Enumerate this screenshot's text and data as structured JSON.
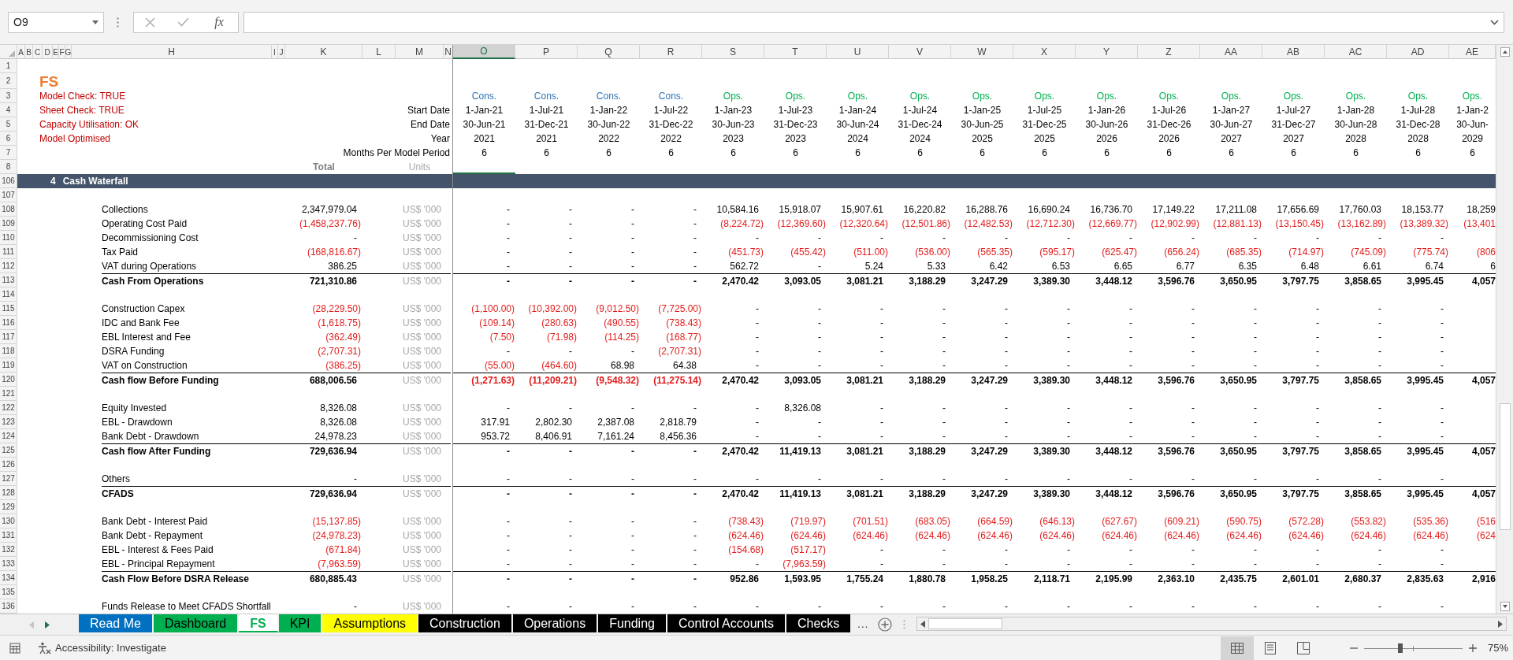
{
  "name_box": "O9",
  "function_button": "fx",
  "columns": [
    {
      "label": "A",
      "selected": false
    },
    {
      "label": "B",
      "selected": false
    },
    {
      "label": "C",
      "selected": false
    },
    {
      "label": "D",
      "selected": false
    },
    {
      "label": "E",
      "selected": false
    },
    {
      "label": "F",
      "selected": false
    },
    {
      "label": "G",
      "selected": false
    },
    {
      "label": "H",
      "selected": false
    },
    {
      "label": "I",
      "selected": false
    },
    {
      "label": "J",
      "selected": false
    },
    {
      "label": "K",
      "selected": false
    },
    {
      "label": "L",
      "selected": false
    },
    {
      "label": "M",
      "selected": false
    },
    {
      "label": "N",
      "selected": false
    },
    {
      "label": "O",
      "selected": true
    },
    {
      "label": "P",
      "selected": false
    },
    {
      "label": "Q",
      "selected": false
    },
    {
      "label": "R",
      "selected": false
    },
    {
      "label": "S",
      "selected": false
    },
    {
      "label": "T",
      "selected": false
    },
    {
      "label": "U",
      "selected": false
    },
    {
      "label": "V",
      "selected": false
    },
    {
      "label": "W",
      "selected": false
    },
    {
      "label": "X",
      "selected": false
    },
    {
      "label": "Y",
      "selected": false
    },
    {
      "label": "Z",
      "selected": false
    },
    {
      "label": "AA",
      "selected": false
    },
    {
      "label": "AB",
      "selected": false
    },
    {
      "label": "AC",
      "selected": false
    },
    {
      "label": "AD",
      "selected": false
    },
    {
      "label": "AE",
      "selected": false
    }
  ],
  "sheet": {
    "title": "FS",
    "top_row_numbers": [
      "1",
      "2",
      "3",
      "4",
      "5",
      "6",
      "7",
      "8"
    ],
    "checks": [
      "Model Check: TRUE",
      "Sheet Check: TRUE",
      "Capacity Utilisation: OK",
      "Model Optimised"
    ],
    "period_labels": [
      "Start Date",
      "End Date",
      "Year",
      "Months Per Model Period"
    ],
    "total_heading": "Total",
    "units_heading": "Units",
    "periods": [
      {
        "phase": "Cons.",
        "color": "#2e75b6",
        "start": "1-Jan-21",
        "end": "30-Jun-21",
        "year": "2021",
        "months": "6"
      },
      {
        "phase": "Cons.",
        "color": "#2e75b6",
        "start": "1-Jul-21",
        "end": "31-Dec-21",
        "year": "2021",
        "months": "6"
      },
      {
        "phase": "Cons.",
        "color": "#2e75b6",
        "start": "1-Jan-22",
        "end": "30-Jun-22",
        "year": "2022",
        "months": "6"
      },
      {
        "phase": "Cons.",
        "color": "#2e75b6",
        "start": "1-Jul-22",
        "end": "31-Dec-22",
        "year": "2022",
        "months": "6"
      },
      {
        "phase": "Ops.",
        "color": "#00b050",
        "start": "1-Jan-23",
        "end": "30-Jun-23",
        "year": "2023",
        "months": "6"
      },
      {
        "phase": "Ops.",
        "color": "#00b050",
        "start": "1-Jul-23",
        "end": "31-Dec-23",
        "year": "2023",
        "months": "6"
      },
      {
        "phase": "Ops.",
        "color": "#00b050",
        "start": "1-Jan-24",
        "end": "30-Jun-24",
        "year": "2024",
        "months": "6"
      },
      {
        "phase": "Ops.",
        "color": "#00b050",
        "start": "1-Jul-24",
        "end": "31-Dec-24",
        "year": "2024",
        "months": "6"
      },
      {
        "phase": "Ops.",
        "color": "#00b050",
        "start": "1-Jan-25",
        "end": "30-Jun-25",
        "year": "2025",
        "months": "6"
      },
      {
        "phase": "Ops.",
        "color": "#00b050",
        "start": "1-Jul-25",
        "end": "31-Dec-25",
        "year": "2025",
        "months": "6"
      },
      {
        "phase": "Ops.",
        "color": "#00b050",
        "start": "1-Jan-26",
        "end": "30-Jun-26",
        "year": "2026",
        "months": "6"
      },
      {
        "phase": "Ops.",
        "color": "#00b050",
        "start": "1-Jul-26",
        "end": "31-Dec-26",
        "year": "2026",
        "months": "6"
      },
      {
        "phase": "Ops.",
        "color": "#00b050",
        "start": "1-Jan-27",
        "end": "30-Jun-27",
        "year": "2027",
        "months": "6"
      },
      {
        "phase": "Ops.",
        "color": "#00b050",
        "start": "1-Jul-27",
        "end": "31-Dec-27",
        "year": "2027",
        "months": "6"
      },
      {
        "phase": "Ops.",
        "color": "#00b050",
        "start": "1-Jan-28",
        "end": "30-Jun-28",
        "year": "2028",
        "months": "6"
      },
      {
        "phase": "Ops.",
        "color": "#00b050",
        "start": "1-Jul-28",
        "end": "31-Dec-28",
        "year": "2028",
        "months": "6"
      },
      {
        "phase": "Ops.",
        "color": "#00b050",
        "start": "1-Jan-2",
        "end": "30-Jun-",
        "year": "2029",
        "months": "6"
      }
    ],
    "section": {
      "row_number": "106",
      "number": "4",
      "title": "Cash Waterfall"
    },
    "rows": [
      {
        "number": "107",
        "kind": "blank"
      },
      {
        "number": "108",
        "kind": "item",
        "label": "Collections",
        "total": "2,347,979.04",
        "units": "US$ '000",
        "values": [
          "-",
          "-",
          "-",
          "-",
          "10,584.16",
          "15,918.07",
          "15,907.61",
          "16,220.82",
          "16,288.76",
          "16,690.24",
          "16,736.70",
          "17,149.22",
          "17,211.08",
          "17,656.69",
          "17,760.03",
          "18,153.77",
          "18,259"
        ]
      },
      {
        "number": "109",
        "kind": "item",
        "label": "Operating Cost Paid",
        "total": "(1,458,237.76)",
        "total_negative": true,
        "units": "US$ '000",
        "values": [
          "-",
          "-",
          "-",
          "-",
          "(8,224.72)",
          "(12,369.60)",
          "(12,320.64)",
          "(12,501.86)",
          "(12,482.53)",
          "(12,712.30)",
          "(12,669.77)",
          "(12,902.99)",
          "(12,881.13)",
          "(13,150.45)",
          "(13,162.89)",
          "(13,389.32)",
          "(13,401"
        ],
        "negative": [
          false,
          false,
          false,
          false,
          true,
          true,
          true,
          true,
          true,
          true,
          true,
          true,
          true,
          true,
          true,
          true,
          true
        ]
      },
      {
        "number": "110",
        "kind": "item",
        "label": "Decommissioning Cost",
        "total": "-",
        "units": "US$ '000",
        "values": [
          "-",
          "-",
          "-",
          "-",
          "-",
          "-",
          "-",
          "-",
          "-",
          "-",
          "-",
          "-",
          "-",
          "-",
          "-",
          "-"
        ]
      },
      {
        "number": "111",
        "kind": "item",
        "label": "Tax Paid",
        "total": "(168,816.67)",
        "total_negative": true,
        "units": "US$ '000",
        "values": [
          "-",
          "-",
          "-",
          "-",
          "(451.73)",
          "(455.42)",
          "(511.00)",
          "(536.00)",
          "(565.35)",
          "(595.17)",
          "(625.47)",
          "(656.24)",
          "(685.35)",
          "(714.97)",
          "(745.09)",
          "(775.74)",
          "(806"
        ],
        "negative": [
          false,
          false,
          false,
          false,
          true,
          true,
          true,
          true,
          true,
          true,
          true,
          true,
          true,
          true,
          true,
          true,
          true
        ]
      },
      {
        "number": "112",
        "kind": "item",
        "label": "VAT during Operations",
        "total": "386.25",
        "units": "US$ '000",
        "values": [
          "-",
          "-",
          "-",
          "-",
          "562.72",
          "-",
          "5.24",
          "5.33",
          "6.42",
          "6.53",
          "6.65",
          "6.77",
          "6.35",
          "6.48",
          "6.61",
          "6.74",
          "6"
        ]
      },
      {
        "number": "113",
        "kind": "total",
        "label": "Cash From Operations",
        "total": "721,310.86",
        "units": "US$ '000",
        "values": [
          "-",
          "-",
          "-",
          "-",
          "2,470.42",
          "3,093.05",
          "3,081.21",
          "3,188.29",
          "3,247.29",
          "3,389.30",
          "3,448.12",
          "3,596.76",
          "3,650.95",
          "3,797.75",
          "3,858.65",
          "3,995.45",
          "4,057"
        ]
      },
      {
        "number": "114",
        "kind": "blank"
      },
      {
        "number": "115",
        "kind": "item",
        "label": "Construction Capex",
        "total": "(28,229.50)",
        "total_negative": true,
        "units": "US$ '000",
        "values": [
          "(1,100.00)",
          "(10,392.00)",
          "(9,012.50)",
          "(7,725.00)",
          "-",
          "-",
          "-",
          "-",
          "-",
          "-",
          "-",
          "-",
          "-",
          "-",
          "-",
          "-"
        ],
        "negative": [
          true,
          true,
          true,
          true,
          false,
          false,
          false,
          false,
          false,
          false,
          false,
          false,
          false,
          false,
          false,
          false
        ]
      },
      {
        "number": "116",
        "kind": "item",
        "label": "IDC and Bank Fee",
        "total": "(1,618.75)",
        "total_negative": true,
        "units": "US$ '000",
        "values": [
          "(109.14)",
          "(280.63)",
          "(490.55)",
          "(738.43)",
          "-",
          "-",
          "-",
          "-",
          "-",
          "-",
          "-",
          "-",
          "-",
          "-",
          "-",
          "-"
        ],
        "negative": [
          true,
          true,
          true,
          true,
          false,
          false,
          false,
          false,
          false,
          false,
          false,
          false,
          false,
          false,
          false,
          false
        ]
      },
      {
        "number": "117",
        "kind": "item",
        "label": "EBL Interest and Fee",
        "total": "(362.49)",
        "total_negative": true,
        "units": "US$ '000",
        "values": [
          "(7.50)",
          "(71.98)",
          "(114.25)",
          "(168.77)",
          "-",
          "-",
          "-",
          "-",
          "-",
          "-",
          "-",
          "-",
          "-",
          "-",
          "-",
          "-"
        ],
        "negative": [
          true,
          true,
          true,
          true,
          false,
          false,
          false,
          false,
          false,
          false,
          false,
          false,
          false,
          false,
          false,
          false
        ]
      },
      {
        "number": "118",
        "kind": "item",
        "label": "DSRA Funding",
        "total": "(2,707.31)",
        "total_negative": true,
        "units": "US$ '000",
        "values": [
          "-",
          "-",
          "-",
          "(2,707.31)",
          "-",
          "-",
          "-",
          "-",
          "-",
          "-",
          "-",
          "-",
          "-",
          "-",
          "-",
          "-"
        ],
        "negative": [
          false,
          false,
          false,
          true,
          false,
          false,
          false,
          false,
          false,
          false,
          false,
          false,
          false,
          false,
          false,
          false
        ]
      },
      {
        "number": "119",
        "kind": "item",
        "label": "VAT on Construction",
        "total": "(386.25)",
        "total_negative": true,
        "units": "US$ '000",
        "values": [
          "(55.00)",
          "(464.60)",
          "68.98",
          "64.38",
          "-",
          "-",
          "-",
          "-",
          "-",
          "-",
          "-",
          "-",
          "-",
          "-",
          "-",
          "-"
        ],
        "negative": [
          true,
          true,
          false,
          false,
          false,
          false,
          false,
          false,
          false,
          false,
          false,
          false,
          false,
          false,
          false,
          false
        ]
      },
      {
        "number": "120",
        "kind": "total",
        "label": "Cash flow Before Funding",
        "total": "688,006.56",
        "units": "US$ '000",
        "values": [
          "(1,271.63)",
          "(11,209.21)",
          "(9,548.32)",
          "(11,275.14)",
          "2,470.42",
          "3,093.05",
          "3,081.21",
          "3,188.29",
          "3,247.29",
          "3,389.30",
          "3,448.12",
          "3,596.76",
          "3,650.95",
          "3,797.75",
          "3,858.65",
          "3,995.45",
          "4,057"
        ],
        "negative": [
          true,
          true,
          true,
          true,
          false,
          false,
          false,
          false,
          false,
          false,
          false,
          false,
          false,
          false,
          false,
          false,
          false
        ]
      },
      {
        "number": "121",
        "kind": "blank"
      },
      {
        "number": "122",
        "kind": "item",
        "label": "Equity Invested",
        "total": "8,326.08",
        "units": "US$ '000",
        "values": [
          "-",
          "-",
          "-",
          "-",
          "-",
          "8,326.08",
          "-",
          "-",
          "-",
          "-",
          "-",
          "-",
          "-",
          "-",
          "-",
          "-"
        ]
      },
      {
        "number": "123",
        "kind": "item",
        "label": "EBL - Drawdown",
        "total": "8,326.08",
        "units": "US$ '000",
        "values": [
          "317.91",
          "2,802.30",
          "2,387.08",
          "2,818.79",
          "-",
          "-",
          "-",
          "-",
          "-",
          "-",
          "-",
          "-",
          "-",
          "-",
          "-",
          "-"
        ]
      },
      {
        "number": "124",
        "kind": "item",
        "label": "Bank Debt - Drawdown",
        "total": "24,978.23",
        "units": "US$ '000",
        "values": [
          "953.72",
          "8,406.91",
          "7,161.24",
          "8,456.36",
          "-",
          "-",
          "-",
          "-",
          "-",
          "-",
          "-",
          "-",
          "-",
          "-",
          "-",
          "-"
        ]
      },
      {
        "number": "125",
        "kind": "total",
        "label": "Cash flow After Funding",
        "total": "729,636.94",
        "units": "US$ '000",
        "values": [
          "-",
          "-",
          "-",
          "-",
          "2,470.42",
          "11,419.13",
          "3,081.21",
          "3,188.29",
          "3,247.29",
          "3,389.30",
          "3,448.12",
          "3,596.76",
          "3,650.95",
          "3,797.75",
          "3,858.65",
          "3,995.45",
          "4,057"
        ]
      },
      {
        "number": "126",
        "kind": "blank"
      },
      {
        "number": "127",
        "kind": "item",
        "label": "Others",
        "total": "-",
        "units": "US$ '000",
        "values": [
          "-",
          "-",
          "-",
          "-",
          "-",
          "-",
          "-",
          "-",
          "-",
          "-",
          "-",
          "-",
          "-",
          "-",
          "-",
          "-"
        ]
      },
      {
        "number": "128",
        "kind": "total",
        "label": "CFADS",
        "total": "729,636.94",
        "units": "US$ '000",
        "values": [
          "-",
          "-",
          "-",
          "-",
          "2,470.42",
          "11,419.13",
          "3,081.21",
          "3,188.29",
          "3,247.29",
          "3,389.30",
          "3,448.12",
          "3,596.76",
          "3,650.95",
          "3,797.75",
          "3,858.65",
          "3,995.45",
          "4,057"
        ]
      },
      {
        "number": "129",
        "kind": "blank"
      },
      {
        "number": "130",
        "kind": "item",
        "label": "Bank Debt - Interest Paid",
        "total": "(15,137.85)",
        "total_negative": true,
        "units": "US$ '000",
        "values": [
          "-",
          "-",
          "-",
          "-",
          "(738.43)",
          "(719.97)",
          "(701.51)",
          "(683.05)",
          "(664.59)",
          "(646.13)",
          "(627.67)",
          "(609.21)",
          "(590.75)",
          "(572.28)",
          "(553.82)",
          "(535.36)",
          "(516"
        ],
        "negative": [
          false,
          false,
          false,
          false,
          true,
          true,
          true,
          true,
          true,
          true,
          true,
          true,
          true,
          true,
          true,
          true,
          true
        ]
      },
      {
        "number": "131",
        "kind": "item",
        "label": "Bank Debt - Repayment",
        "total": "(24,978.23)",
        "total_negative": true,
        "units": "US$ '000",
        "values": [
          "-",
          "-",
          "-",
          "-",
          "(624.46)",
          "(624.46)",
          "(624.46)",
          "(624.46)",
          "(624.46)",
          "(624.46)",
          "(624.46)",
          "(624.46)",
          "(624.46)",
          "(624.46)",
          "(624.46)",
          "(624.46)",
          "(624"
        ],
        "negative": [
          false,
          false,
          false,
          false,
          true,
          true,
          true,
          true,
          true,
          true,
          true,
          true,
          true,
          true,
          true,
          true,
          true
        ]
      },
      {
        "number": "132",
        "kind": "item",
        "label": "EBL - Interest & Fees Paid",
        "total": "(671.84)",
        "total_negative": true,
        "units": "US$ '000",
        "values": [
          "-",
          "-",
          "-",
          "-",
          "(154.68)",
          "(517.17)",
          "-",
          "-",
          "-",
          "-",
          "-",
          "-",
          "-",
          "-",
          "-",
          "-"
        ],
        "negative": [
          false,
          false,
          false,
          false,
          true,
          true,
          false,
          false,
          false,
          false,
          false,
          false,
          false,
          false,
          false,
          false
        ]
      },
      {
        "number": "133",
        "kind": "item",
        "label": "EBL - Principal Repayment",
        "total": "(7,963.59)",
        "total_negative": true,
        "units": "US$ '000",
        "values": [
          "-",
          "-",
          "-",
          "-",
          "-",
          "(7,963.59)",
          "-",
          "-",
          "-",
          "-",
          "-",
          "-",
          "-",
          "-",
          "-",
          "-"
        ],
        "negative": [
          false,
          false,
          false,
          false,
          false,
          true,
          false,
          false,
          false,
          false,
          false,
          false,
          false,
          false,
          false,
          false
        ]
      },
      {
        "number": "134",
        "kind": "total",
        "label": "Cash Flow Before DSRA Release",
        "total": "680,885.43",
        "units": "US$ '000",
        "values": [
          "-",
          "-",
          "-",
          "-",
          "952.86",
          "1,593.95",
          "1,755.24",
          "1,880.78",
          "1,958.25",
          "2,118.71",
          "2,195.99",
          "2,363.10",
          "2,435.75",
          "2,601.01",
          "2,680.37",
          "2,835.63",
          "2,916"
        ]
      },
      {
        "number": "135",
        "kind": "blank"
      },
      {
        "number": "136",
        "kind": "item",
        "label": "Funds Release to Meet CFADS Shortfall",
        "total": "-",
        "units": "US$ '000",
        "values": [
          "-",
          "-",
          "-",
          "-",
          "-",
          "-",
          "-",
          "-",
          "-",
          "-",
          "-",
          "-",
          "-",
          "-",
          "-",
          "-"
        ]
      }
    ]
  },
  "tabs": [
    {
      "label": "Read Me",
      "color": "#0070c0",
      "selected": false
    },
    {
      "label": "Dashboard",
      "color": "#00b050",
      "selected": false
    },
    {
      "label": "FS",
      "color": "#00b050",
      "selected": true
    },
    {
      "label": "KPI",
      "color": "#00b050",
      "selected": false
    },
    {
      "label": "Assumptions",
      "color": "#ffff00",
      "selected": false
    },
    {
      "label": "Construction",
      "color": "#000000",
      "selected": false
    },
    {
      "label": "Operations",
      "color": "#000000",
      "selected": false
    },
    {
      "label": "Funding",
      "color": "#000000",
      "selected": false
    },
    {
      "label": "Control Accounts",
      "color": "#000000",
      "selected": false
    },
    {
      "label": "Checks",
      "color": "#000000",
      "selected": false
    }
  ],
  "more_tabs": "…",
  "status_bar": {
    "accessibility": "Accessibility: Investigate",
    "views": [
      {
        "kind": "normal",
        "selected": true
      },
      {
        "kind": "page_layout",
        "selected": false
      },
      {
        "kind": "page_break",
        "selected": false
      }
    ],
    "zoom_slider": {
      "level": 0.37
    },
    "zoom": "75%"
  }
}
